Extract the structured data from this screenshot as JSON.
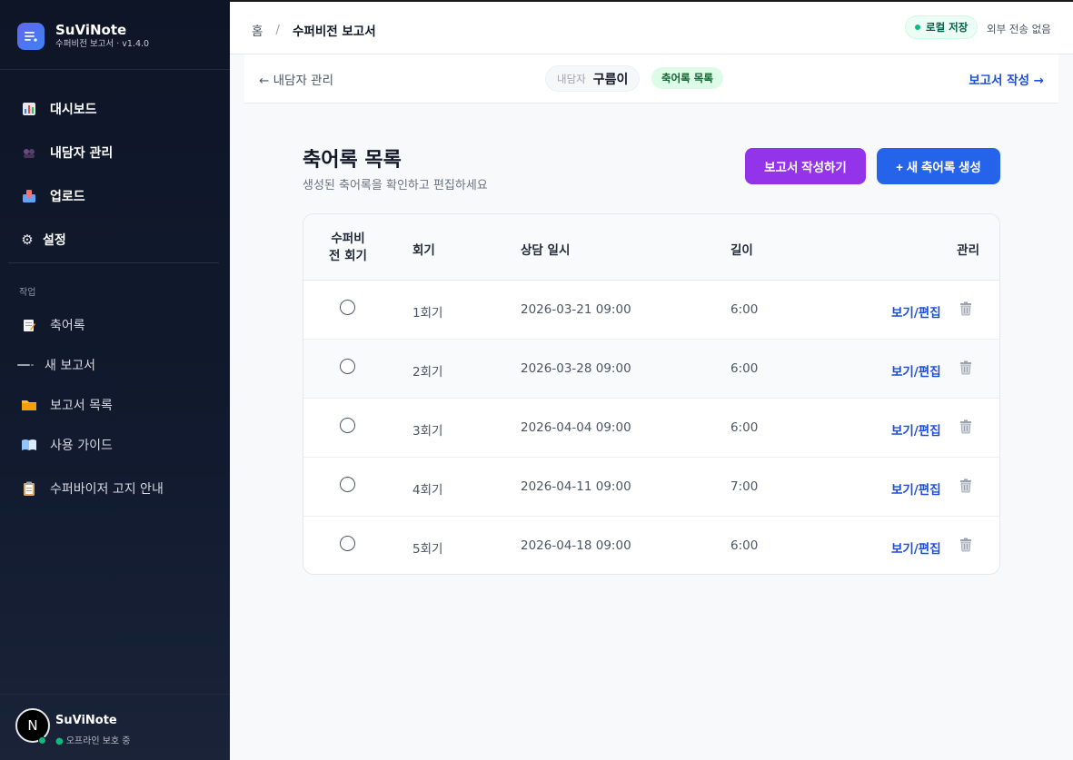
{
  "brand": {
    "name": "SuViNote",
    "subtitle": "수퍼비전 보고서 · v1.4.0"
  },
  "nav": {
    "main": [
      {
        "label": "대시보드",
        "icon": "chart-icon"
      },
      {
        "label": "내담자 관리",
        "icon": "people-icon"
      },
      {
        "label": "업로드",
        "icon": "inbox-icon"
      },
      {
        "label": "설정",
        "icon": "gear-icon"
      }
    ],
    "section_label": "작업",
    "work": [
      {
        "label": "축어록",
        "icon": "memo-icon"
      },
      {
        "label": "새 보고서",
        "icon": "dash-icon"
      },
      {
        "label": "보고서 목록",
        "icon": "folder-icon"
      },
      {
        "label": "사용 가이드",
        "icon": "book-icon"
      },
      {
        "label": "수퍼바이저 고지 안내",
        "icon": "clipboard-icon"
      }
    ]
  },
  "user": {
    "avatar": "N",
    "name": "SuViNote",
    "status": "오프라인 보호 중"
  },
  "topbar": {
    "breadcrumb_home": "홈",
    "breadcrumb_sep": "/",
    "breadcrumb_current": "수퍼비전 보고서",
    "local_badge": "로컬 저장",
    "no_transfer": "외부 전송 없음"
  },
  "subbar": {
    "back_label": "← 내담자 관리",
    "client_label": "내담자",
    "client_name": "구름이",
    "records_pill": "축어록 목록",
    "write_link": "보고서 작성 →"
  },
  "page": {
    "title": "축어록 목록",
    "description": "생성된 축어록을 확인하고 편집하세요",
    "write_report_button": "보고서 작성하기",
    "new_record_button": "+ 새 축어록 생성"
  },
  "table": {
    "headers": {
      "supervision_line1": "수퍼비",
      "supervision_line2": "전 회기",
      "round": "회기",
      "date": "상담 일시",
      "length": "길이",
      "manage": "관리"
    },
    "rows": [
      {
        "round": "1회기",
        "date": "2026-03-21 09:00",
        "length": "6:00",
        "edit": "보기/편집"
      },
      {
        "round": "2회기",
        "date": "2026-03-28 09:00",
        "length": "6:00",
        "edit": "보기/편집"
      },
      {
        "round": "3회기",
        "date": "2026-04-04 09:00",
        "length": "6:00",
        "edit": "보기/편집"
      },
      {
        "round": "4회기",
        "date": "2026-04-11 09:00",
        "length": "7:00",
        "edit": "보기/편집"
      },
      {
        "round": "5회기",
        "date": "2026-04-18 09:00",
        "length": "6:00",
        "edit": "보기/편집"
      }
    ]
  }
}
